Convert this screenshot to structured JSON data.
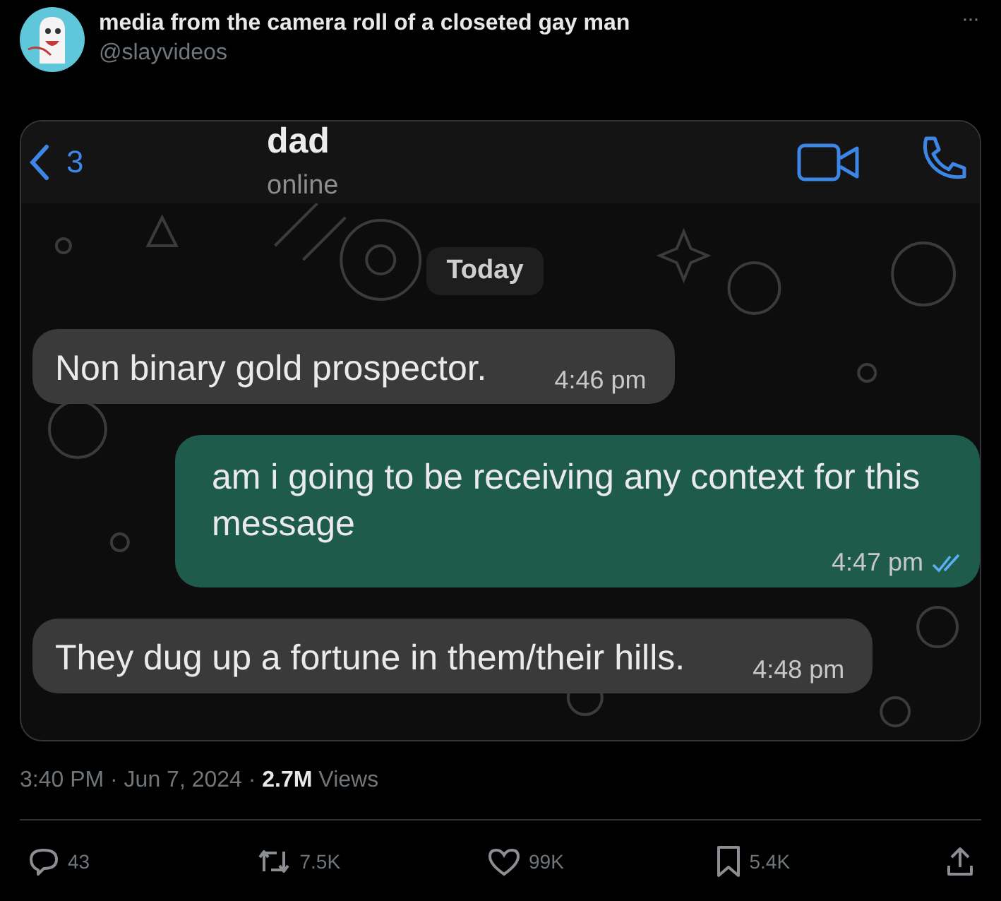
{
  "post": {
    "author": {
      "name": "media from the camera roll of a closeted gay man",
      "handle": "@slayvideos"
    },
    "more": "···"
  },
  "media": {
    "chat": {
      "back_count": "3",
      "contact": "dad",
      "status": "online",
      "date_divider": "Today",
      "messages": [
        {
          "kind": "incoming",
          "text": "Non binary gold prospector.",
          "time": "4:46 pm"
        },
        {
          "kind": "outgoing",
          "text": "am i going to be receiving any context for this message",
          "time": "4:47 pm",
          "read": true
        },
        {
          "kind": "incoming",
          "text": "They dug up a fortune in them/their hills.",
          "time": "4:48 pm"
        }
      ]
    }
  },
  "meta": "3:40 PM · Jun 7, 2024 · **2.7M** Views",
  "actions": [
    {
      "kind": "reply",
      "count": "43"
    },
    {
      "kind": "repost",
      "count": "7.5K"
    },
    {
      "kind": "like",
      "count": "99K"
    },
    {
      "kind": "bookmark",
      "count": "5.4K"
    },
    {
      "kind": "share"
    }
  ]
}
